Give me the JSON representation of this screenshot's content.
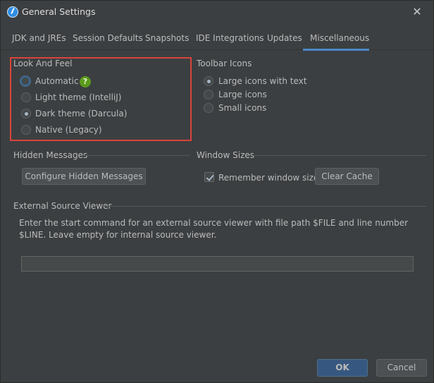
{
  "window": {
    "title": "General Settings"
  },
  "tabs": [
    {
      "label": "JDK and JREs"
    },
    {
      "label": "Session Defaults"
    },
    {
      "label": "Snapshots"
    },
    {
      "label": "IDE Integrations"
    },
    {
      "label": "Updates"
    },
    {
      "label": "Miscellaneous"
    }
  ],
  "active_tab": "Miscellaneous",
  "look_and_feel": {
    "title": "Look And Feel",
    "options": [
      {
        "label": "Automatic",
        "checked": false
      },
      {
        "label": "Light theme (IntelliJ)",
        "checked": false
      },
      {
        "label": "Dark theme (Darcula)",
        "checked": true
      },
      {
        "label": "Native (Legacy)",
        "checked": false
      }
    ],
    "help": "?"
  },
  "toolbar_icons": {
    "title": "Toolbar Icons",
    "options": [
      {
        "label": "Large icons with text",
        "checked": true
      },
      {
        "label": "Large icons",
        "checked": false
      },
      {
        "label": "Small icons",
        "checked": false
      }
    ]
  },
  "hidden_messages": {
    "title": "Hidden Messages",
    "button": "Configure Hidden Messages"
  },
  "window_sizes": {
    "title": "Window Sizes",
    "checkbox_label": "Remember window sizes",
    "checked": true,
    "button": "Clear Cache"
  },
  "external_viewer": {
    "title": "External Source Viewer",
    "description": "Enter the start command for an external source viewer with file path $FILE and line number $LINE. Leave empty for internal source viewer.",
    "value": ""
  },
  "footer": {
    "ok": "OK",
    "cancel": "Cancel"
  },
  "colors": {
    "accent": "#4a88c7",
    "highlight": "#d9453c",
    "help": "#5a9a1c"
  }
}
